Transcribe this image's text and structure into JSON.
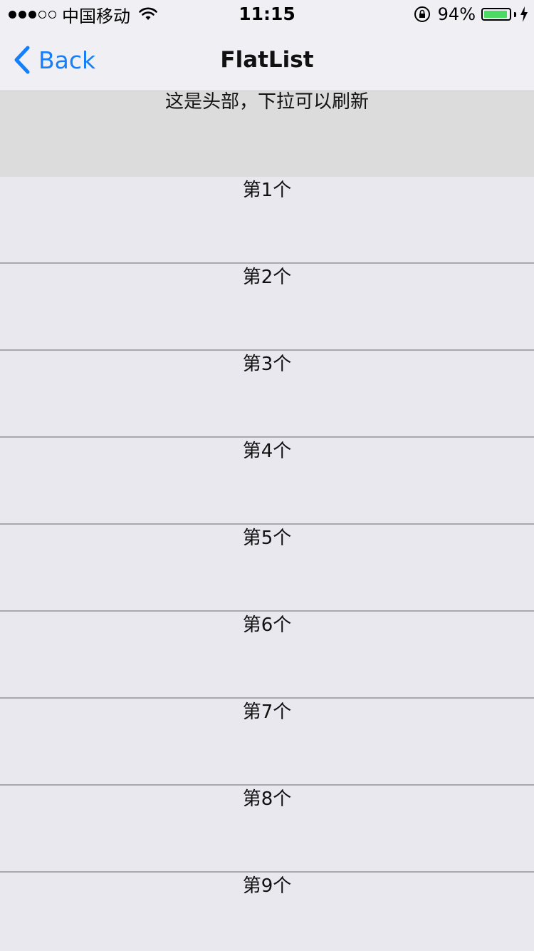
{
  "status_bar": {
    "carrier": "中国移动",
    "time": "11:15",
    "battery_percent": "94%",
    "battery_level": 0.94,
    "signal_filled": 3,
    "signal_total": 5
  },
  "nav": {
    "back_label": "Back",
    "title": "FlatList"
  },
  "list": {
    "header_text": "这是头部，下拉可以刷新",
    "items": [
      {
        "label": "第1个"
      },
      {
        "label": "第2个"
      },
      {
        "label": "第3个"
      },
      {
        "label": "第4个"
      },
      {
        "label": "第5个"
      },
      {
        "label": "第6个"
      },
      {
        "label": "第7个"
      },
      {
        "label": "第8个"
      },
      {
        "label": "第9个"
      }
    ]
  },
  "colors": {
    "accent": "#147efb",
    "battery": "#4cd964",
    "background": "#e9e8ee",
    "header_background": "#dcdcdc"
  }
}
